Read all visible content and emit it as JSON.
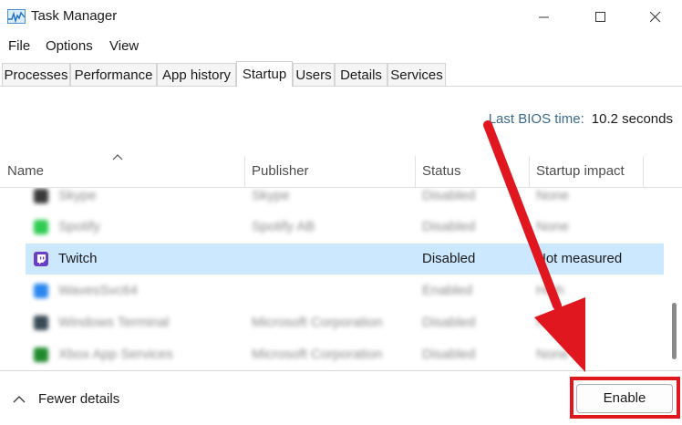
{
  "window": {
    "title": "Task Manager"
  },
  "menu": {
    "items": [
      "File",
      "Options",
      "View"
    ]
  },
  "tabs": [
    "Processes",
    "Performance",
    "App history",
    "Startup",
    "Users",
    "Details",
    "Services"
  ],
  "active_tab": "Startup",
  "bios": {
    "label": "Last BIOS time:",
    "value": "10.2 seconds"
  },
  "columns": {
    "name": "Name",
    "publisher": "Publisher",
    "status": "Status",
    "impact": "Startup impact"
  },
  "rows": [
    {
      "name": "Skype",
      "publisher": "Skype",
      "status": "Disabled",
      "impact": "None",
      "icon": "skype-app-icon",
      "color": "#3a3a3a"
    },
    {
      "name": "Spotify",
      "publisher": "Spotify AB",
      "status": "Disabled",
      "impact": "None",
      "icon": "spotify-app-icon",
      "color": "#2ecc52"
    },
    {
      "name": "Twitch",
      "publisher": "",
      "status": "Disabled",
      "impact": "Not measured",
      "icon": "twitch-app-icon",
      "color": "#6a3fc8"
    },
    {
      "name": "WavesSvc64",
      "publisher": "",
      "status": "Enabled",
      "impact": "High",
      "icon": "waves-app-icon",
      "color": "#2a86f0"
    },
    {
      "name": "Windows Terminal",
      "publisher": "Microsoft Corporation",
      "status": "Disabled",
      "impact": "None",
      "icon": "terminal-app-icon",
      "color": "#3a4a55"
    },
    {
      "name": "Xbox App Services",
      "publisher": "Microsoft Corporation",
      "status": "Disabled",
      "impact": "None",
      "icon": "xbox-app-icon",
      "color": "#1f8a2c"
    }
  ],
  "footer": {
    "fewer_details": "Fewer details",
    "enable_button": "Enable"
  },
  "colors": {
    "selection": "#cce8ff",
    "annotation": "#e0171f"
  }
}
